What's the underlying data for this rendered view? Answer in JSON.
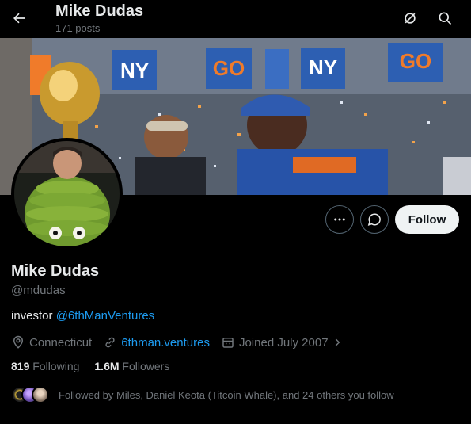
{
  "header": {
    "title": "Mike Dudas",
    "post_count": "171 posts"
  },
  "profile": {
    "name": "Mike Dudas",
    "handle": "@mdudas",
    "bio_text": "investor ",
    "bio_mention": "@6thManVentures",
    "location": "Connecticut",
    "website": "6thman.ventures",
    "joined": "Joined July 2007",
    "following_count": "819",
    "following_label": "Following",
    "followers_count": "1.6M",
    "followers_label": "Followers",
    "followed_by": "Followed by Miles, Daniel Keota (Titcoin Whale), and 24 others you follow"
  },
  "actions": {
    "follow_label": "Follow"
  },
  "colors": {
    "background": "#000000",
    "accent": "#1d9bf0",
    "muted": "#71767b",
    "text": "#e7e9ea",
    "follow_bg": "#eff3f4"
  },
  "icons": [
    "back-arrow-icon",
    "grok-icon",
    "search-icon",
    "more-icon",
    "message-icon",
    "location-icon",
    "link-icon",
    "calendar-icon",
    "chevron-right-icon"
  ]
}
